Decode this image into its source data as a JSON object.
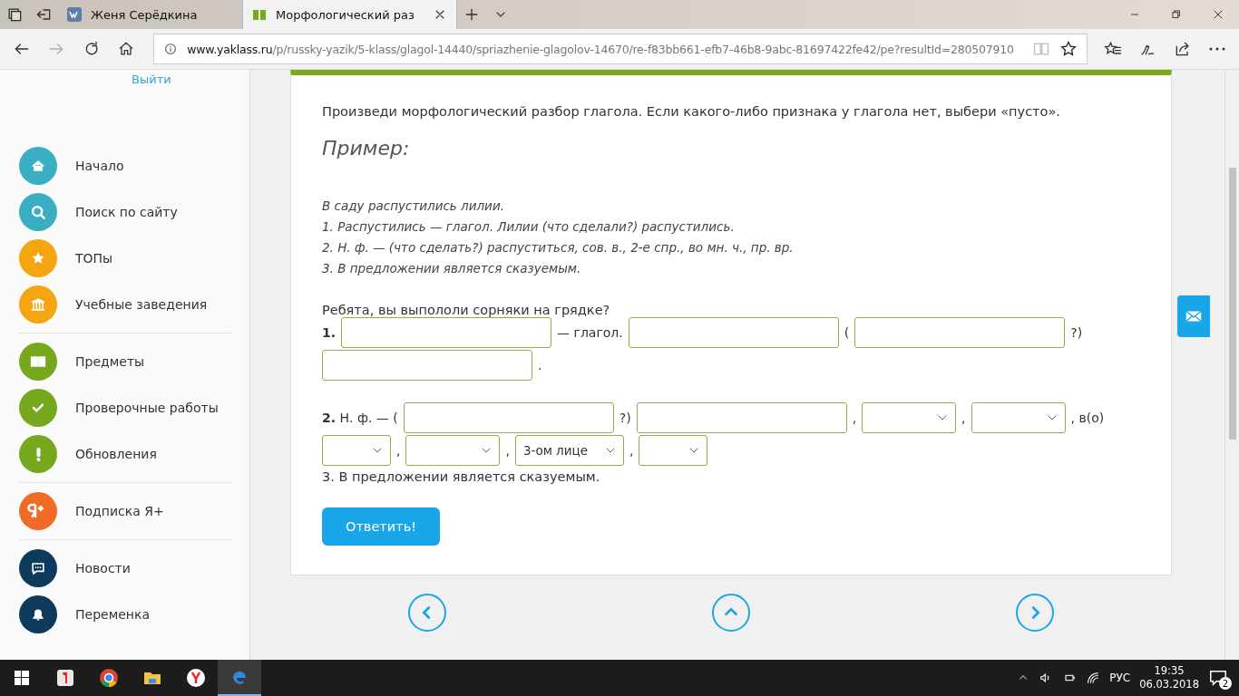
{
  "browser": {
    "tabs": [
      {
        "label": "Женя Серёдкина",
        "selected": false
      },
      {
        "label": "Морфологический раз",
        "selected": true
      }
    ],
    "url": {
      "domain": "www.yaklass.ru",
      "path": "/p/russky-yazik/5-klass/glagol-14440/spriazhenie-glagolov-14670/re-f83bb661-efb7-46b8-9abc-81697422fe42/pe?resultId=280507910"
    }
  },
  "sidebar": {
    "logout": "Выйти",
    "groups": [
      [
        {
          "label": "Начало",
          "color": "#3aaec2"
        },
        {
          "label": "Поиск по сайту",
          "color": "#3aaec2"
        },
        {
          "label": "ТОПы",
          "color": "#f5a50f"
        },
        {
          "label": "Учебные заведения",
          "color": "#f5a50f"
        }
      ],
      [
        {
          "label": "Предметы",
          "color": "#75a81d"
        },
        {
          "label": "Проверочные работы",
          "color": "#75a81d"
        },
        {
          "label": "Обновления",
          "color": "#75a81d"
        }
      ],
      [
        {
          "label": "Подписка Я+",
          "color": "#f06a28"
        }
      ],
      [
        {
          "label": "Новости",
          "color": "#0e3a5c"
        },
        {
          "label": "Переменка",
          "color": "#0e3a5c"
        }
      ]
    ]
  },
  "task": {
    "instruction": "Произведи морфологический разбор глагола. Если какого-либо признака у глагола нет, выбери «пусто».",
    "example_title": "Пример:",
    "example_lines": [
      "В саду распустились лилии.",
      "1. Распустились — глагол. Лилии (что сделали?) распустились.",
      "2. Н. ф. — (что сделать?) распуститься, сов. в., 2-е спр., во мн. ч., пр. вр.",
      "3. В предложении является сказуемым."
    ],
    "question": "Ребята, вы выпололи сорняки на грядке?",
    "answer_lines": [
      [
        {
          "kind": "label",
          "text": "**1.**"
        },
        {
          "kind": "text"
        },
        {
          "kind": "label",
          "text": "— глагол."
        },
        {
          "kind": "text"
        },
        {
          "kind": "label",
          "text": "("
        },
        {
          "kind": "text"
        },
        {
          "kind": "label",
          "text": "?)"
        },
        {
          "kind": "break"
        },
        {
          "kind": "text"
        },
        {
          "kind": "label",
          "text": "."
        }
      ],
      [
        {
          "kind": "label",
          "text": "**2.** Н. ф. — ("
        },
        {
          "kind": "text"
        },
        {
          "kind": "label",
          "text": "?)"
        },
        {
          "kind": "text"
        },
        {
          "kind": "label",
          "text": ","
        },
        {
          "kind": "select"
        },
        {
          "kind": "label",
          "text": ","
        },
        {
          "kind": "select"
        },
        {
          "kind": "label",
          "text": ", в(о)"
        },
        {
          "kind": "break"
        },
        {
          "kind": "select"
        },
        {
          "kind": "label",
          "text": ","
        },
        {
          "kind": "select"
        },
        {
          "kind": "label",
          "text": ","
        },
        {
          "kind": "select",
          "value": "3-ом лице"
        },
        {
          "kind": "label",
          "text": ","
        },
        {
          "kind": "select"
        }
      ]
    ],
    "sentence_3": "3. В предложении является сказуемым.",
    "submit": "Ответить!"
  },
  "taskbar": {
    "apps": [
      {
        "selected": false
      },
      {
        "selected": false
      },
      {
        "selected": false
      },
      {
        "selected": false
      },
      {
        "selected": true
      }
    ],
    "language": "РУС",
    "time": "19:35",
    "date": "06.03.2018",
    "notifications": "2"
  }
}
